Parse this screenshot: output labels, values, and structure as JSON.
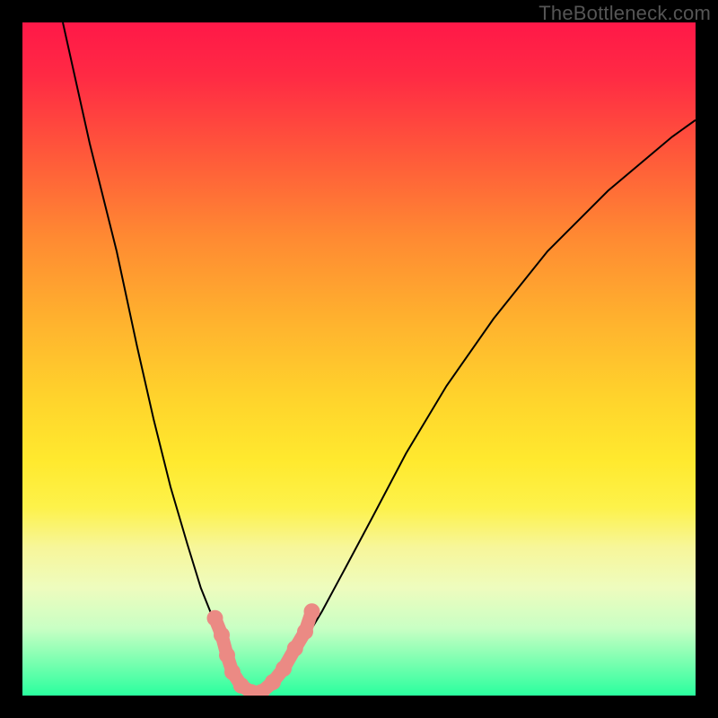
{
  "watermark": "TheBottleneck.com",
  "chart_data": {
    "type": "line",
    "title": "",
    "xlabel": "",
    "ylabel": "",
    "xlim": [
      0,
      1
    ],
    "ylim": [
      0,
      1
    ],
    "x": [
      0.0,
      0.05,
      0.1,
      0.15,
      0.2,
      0.225,
      0.25,
      0.275,
      0.3,
      0.325,
      0.35,
      0.375,
      0.4,
      0.45,
      0.5,
      0.55,
      0.6,
      0.65,
      0.7,
      0.75,
      0.8,
      0.85,
      0.9,
      0.95,
      1.0
    ],
    "series": [
      {
        "name": "left-branch",
        "x": [
          0.06,
          0.1,
          0.14,
          0.17,
          0.195,
          0.22,
          0.245,
          0.265,
          0.285,
          0.3,
          0.315,
          0.33,
          0.34
        ],
        "y": [
          1.0,
          0.82,
          0.66,
          0.52,
          0.41,
          0.31,
          0.225,
          0.16,
          0.11,
          0.07,
          0.04,
          0.015,
          0.005
        ]
      },
      {
        "name": "right-branch",
        "x": [
          0.36,
          0.375,
          0.395,
          0.415,
          0.445,
          0.48,
          0.52,
          0.57,
          0.63,
          0.7,
          0.78,
          0.87,
          0.965,
          1.0
        ],
        "y": [
          0.005,
          0.02,
          0.045,
          0.075,
          0.125,
          0.19,
          0.265,
          0.36,
          0.46,
          0.56,
          0.66,
          0.75,
          0.83,
          0.855
        ]
      }
    ],
    "markers": {
      "description": "salmon dotted segment near trough",
      "points": [
        {
          "x": 0.286,
          "y": 0.115
        },
        {
          "x": 0.296,
          "y": 0.09
        },
        {
          "x": 0.304,
          "y": 0.06
        },
        {
          "x": 0.312,
          "y": 0.035
        },
        {
          "x": 0.325,
          "y": 0.015
        },
        {
          "x": 0.34,
          "y": 0.005
        },
        {
          "x": 0.355,
          "y": 0.005
        },
        {
          "x": 0.372,
          "y": 0.02
        },
        {
          "x": 0.388,
          "y": 0.04
        },
        {
          "x": 0.405,
          "y": 0.07
        },
        {
          "x": 0.42,
          "y": 0.095
        },
        {
          "x": 0.43,
          "y": 0.125
        }
      ]
    }
  }
}
